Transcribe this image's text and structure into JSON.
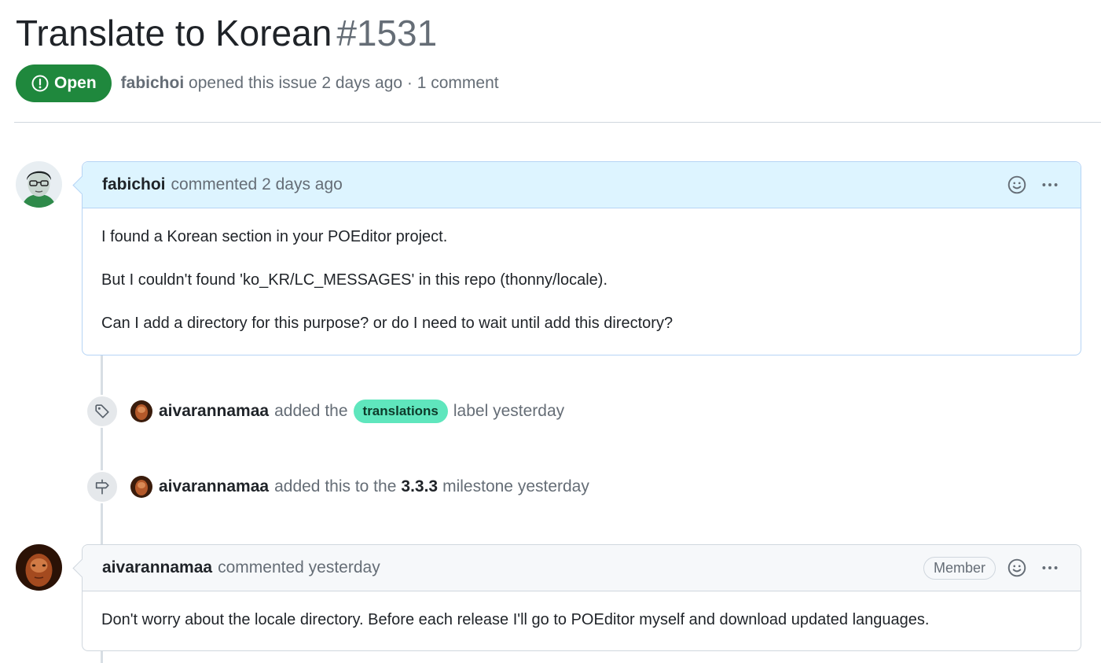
{
  "issue": {
    "title": "Translate to Korean",
    "number": "#1531",
    "state": "Open",
    "author": "fabichoi",
    "opened_text": "opened this issue 2 days ago · 1 comment"
  },
  "comments": [
    {
      "author": "fabichoi",
      "action": "commented 2 days ago",
      "paragraphs": [
        "I found a Korean section in your POEditor project.",
        "But I couldn't found 'ko_KR/LC_MESSAGES' in this repo (thonny/locale).",
        "Can I add a directory for this purpose? or do I need to wait until add this directory?"
      ]
    },
    {
      "author": "aivarannamaa",
      "action": "commented yesterday",
      "role": "Member",
      "paragraphs": [
        "Don't worry about the locale directory. Before each release I'll go to POEditor myself and download updated languages."
      ]
    }
  ],
  "events": [
    {
      "icon": "tag-icon",
      "actor": "aivarannamaa",
      "text_before": "added the",
      "label": "translations",
      "text_after": "label yesterday"
    },
    {
      "icon": "milestone-icon",
      "actor": "aivarannamaa",
      "text_before": "added this to the",
      "milestone": "3.3.3",
      "text_after": "milestone yesterday"
    }
  ],
  "colors": {
    "open_badge": "#1f883d",
    "label_translations": "#5fe6bd",
    "highlight_header": "#ddf4ff"
  }
}
